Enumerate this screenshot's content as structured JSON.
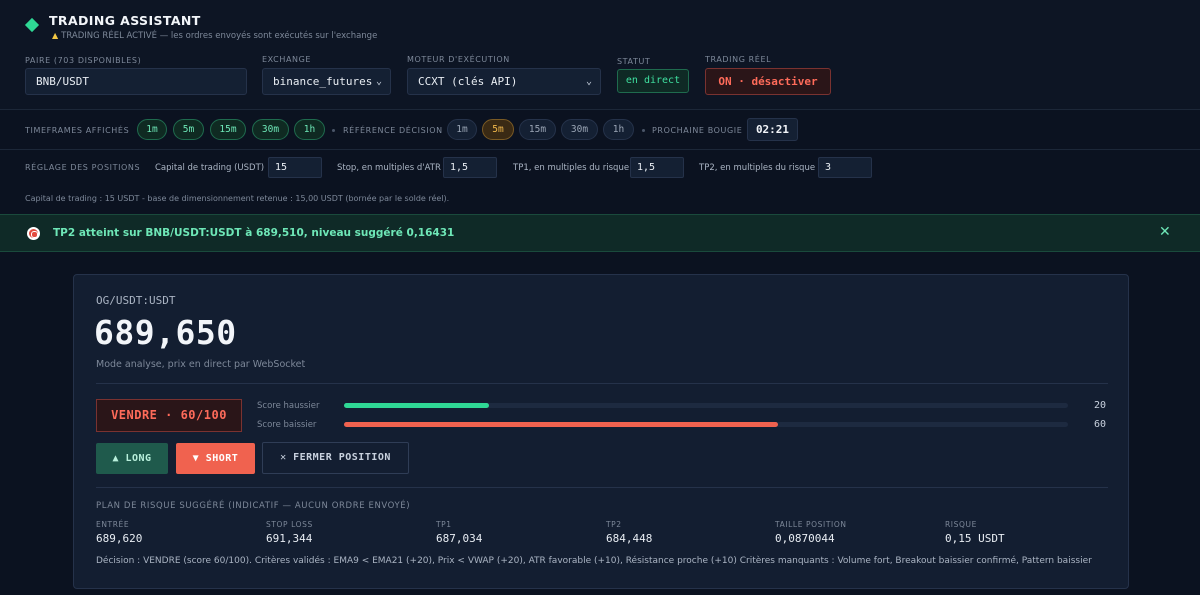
{
  "header": {
    "title": "TRADING ASSISTANT",
    "subtitle": "TRADING RÉEL ACTIVÉ — les ordres envoyés sont exécutés sur l'exchange",
    "pair_label": "PAIRE (703 DISPONIBLES)",
    "pair_value": "BNB/USDT",
    "exchange_label": "EXCHANGE",
    "exchange_value": "binance_futures",
    "engine_label": "MOTEUR D'EXÉCUTION",
    "engine_value": "CCXT (clés API)",
    "status_label": "STATUT",
    "status_value": "en direct",
    "real_label": "TRADING RÉEL",
    "real_value": "ON · désactiver"
  },
  "timeframes": {
    "shown_label": "TIMEFRAMES AFFICHÉS",
    "shown": [
      "1m",
      "5m",
      "15m",
      "30m",
      "1h"
    ],
    "decision_label": "RÉFÉRENCE DÉCISION",
    "decision": [
      "1m",
      "5m",
      "15m",
      "30m",
      "1h"
    ],
    "decision_selected": "5m",
    "next_candle_label": "PROCHAINE BOUGIE",
    "next_candle_value": "02:21"
  },
  "positions": {
    "row_label": "RÉGLAGE DES POSITIONS",
    "capital_label": "Capital de trading (USDT)",
    "capital_value": "15",
    "stop_label": "Stop, en multiples d'ATR",
    "stop_value": "1,5",
    "tp1_label": "TP1, en multiples du risque",
    "tp1_value": "1,5",
    "tp2_label": "TP2, en multiples du risque",
    "tp2_value": "3",
    "note": "Capital de trading : 15 USDT - base de dimensionnement retenue : 15,00 USDT (bornée par le solde réel)."
  },
  "alert": {
    "text": "TP2 atteint sur BNB/USDT:USDT à 689,510, niveau suggéré 0,16431"
  },
  "card": {
    "symbol": "OG/USDT:USDT",
    "price": "689,650",
    "mode": "Mode analyse, prix en direct par WebSocket",
    "signal": "VENDRE · 60/100",
    "bull_label": "Score haussier",
    "bull_score": 20,
    "bull_display": "20",
    "bear_label": "Score baissier",
    "bear_score": 60,
    "bear_display": "60",
    "long_label": "▲ LONG",
    "short_label": "▼ SHORT",
    "close_label": "✕ FERMER POSITION",
    "plan_title": "PLAN DE RISQUE SUGGÉRÉ (INDICATIF — AUCUN ORDRE ENVOYÉ)",
    "plan": [
      {
        "label": "ENTRÉE",
        "value": "689,620"
      },
      {
        "label": "STOP LOSS",
        "value": "691,344"
      },
      {
        "label": "TP1",
        "value": "687,034"
      },
      {
        "label": "TP2",
        "value": "684,448"
      },
      {
        "label": "TAILLE POSITION",
        "value": "0,0870044"
      },
      {
        "label": "RISQUE",
        "value": "0,15 USDT"
      }
    ],
    "decision": "Décision : VENDRE (score 60/100). Critères validés : EMA9 < EMA21 (+20), Prix < VWAP (+20), ATR favorable (+10), Résistance proche (+10) Critères manquants : Volume fort, Breakout baissier confirmé, Pattern baissier"
  },
  "colors": {
    "bull": "#2fd895",
    "bear": "#f0624f",
    "accent": "#2fd895"
  }
}
